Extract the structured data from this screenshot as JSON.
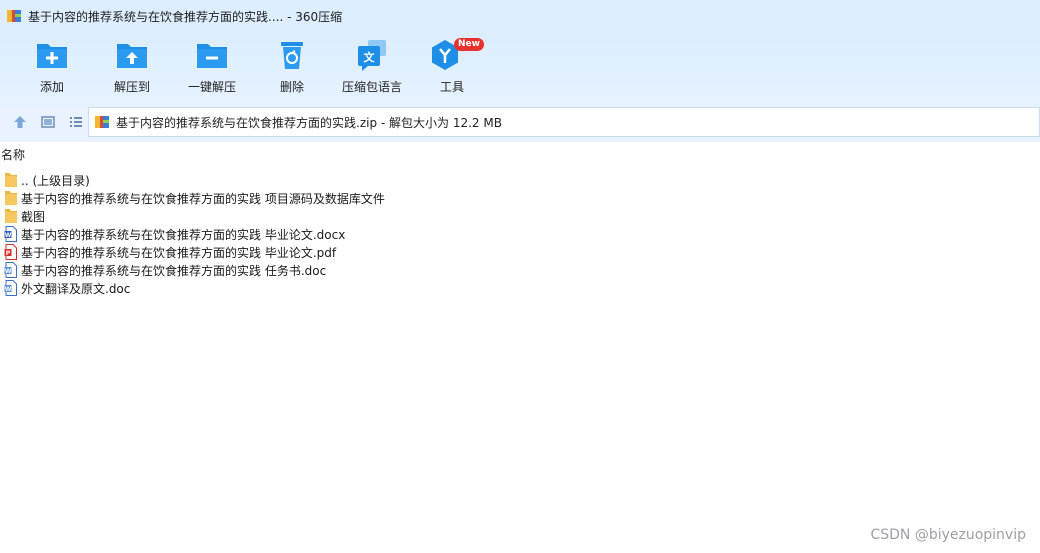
{
  "window": {
    "title": "基于内容的推荐系统与在饮食推荐方面的实践.... - 360压缩",
    "app_icon": "archive-icon"
  },
  "toolbar": {
    "items": [
      {
        "label": "添加",
        "icon": "add-folder-icon"
      },
      {
        "label": "解压到",
        "icon": "extract-to-icon"
      },
      {
        "label": "一键解压",
        "icon": "one-click-extract-icon"
      },
      {
        "label": "删除",
        "icon": "delete-icon"
      },
      {
        "label": "压缩包语言",
        "icon": "language-icon"
      },
      {
        "label": "工具",
        "icon": "tools-icon",
        "badge": "New"
      }
    ]
  },
  "navbar": {
    "path": "基于内容的推荐系统与在饮食推荐方面的实践.zip - 解包大小为 12.2 MB"
  },
  "list": {
    "column_name": "名称",
    "rows": [
      {
        "name": ".. (上级目录)",
        "type": "folder"
      },
      {
        "name": "基于内容的推荐系统与在饮食推荐方面的实践 项目源码及数据库文件",
        "type": "folder"
      },
      {
        "name": "截图",
        "type": "folder"
      },
      {
        "name": "基于内容的推荐系统与在饮食推荐方面的实践 毕业论文.docx",
        "type": "word"
      },
      {
        "name": "基于内容的推荐系统与在饮食推荐方面的实践 毕业论文.pdf",
        "type": "pdf"
      },
      {
        "name": "基于内容的推荐系统与在饮食推荐方面的实践 任务书.doc",
        "type": "word"
      },
      {
        "name": "外文翻译及原文.doc",
        "type": "word"
      }
    ]
  },
  "watermark": "CSDN @biyezuopinvip",
  "colors": {
    "accent_blue": "#1e8fe6",
    "badge_red": "#e8322f",
    "folder_yellow": "#f6c85f",
    "pdf_red": "#d9322b"
  }
}
